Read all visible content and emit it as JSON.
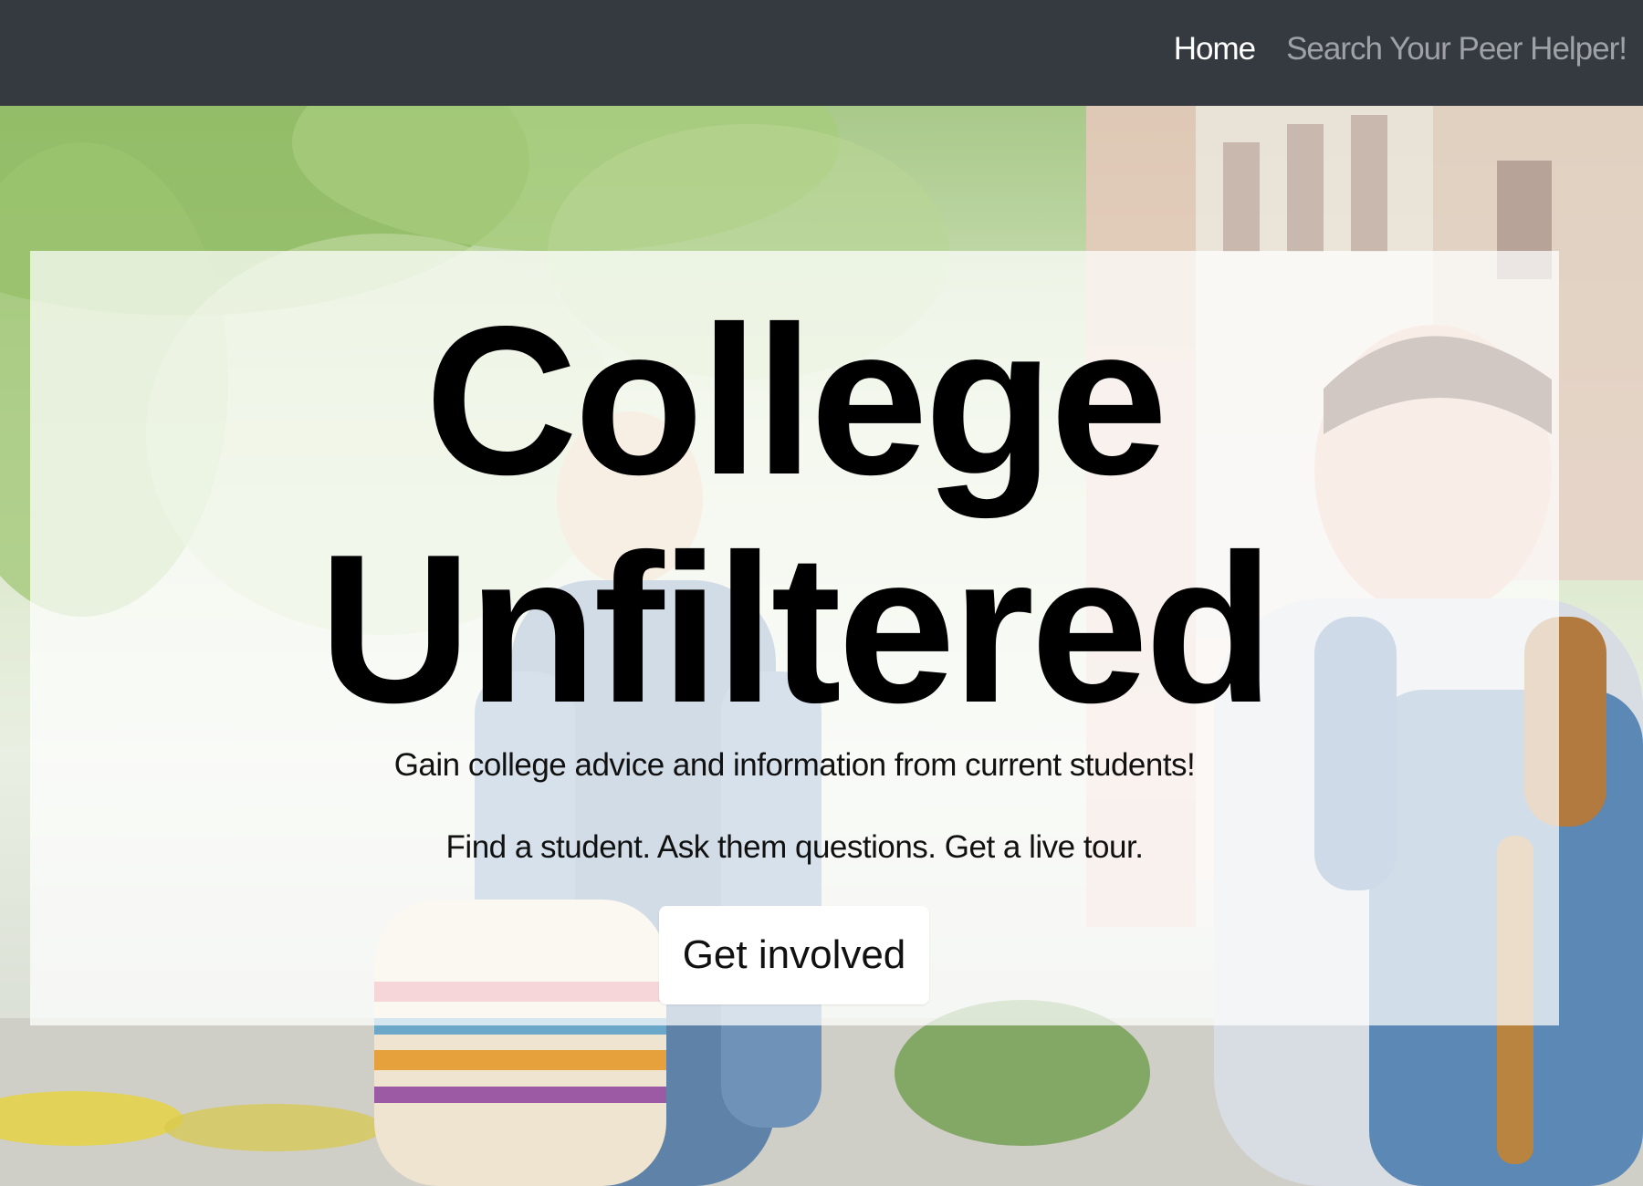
{
  "navbar": {
    "links": [
      {
        "label": "Home",
        "active": true
      },
      {
        "label": "Search Your Peer Helper!",
        "active": false
      }
    ],
    "background": "#343a40"
  },
  "hero": {
    "title_line1": "College",
    "title_line2": "Unfiltered",
    "lead1": "Gain college advice and information from current students!",
    "lead2": "Find a student. Ask them questions. Get a live tour.",
    "cta_label": "Get involved"
  },
  "colors": {
    "nav_active": "#ffffff",
    "nav_muted": "#9ea2a6",
    "panel": "rgba(255,255,255,0.72)"
  }
}
